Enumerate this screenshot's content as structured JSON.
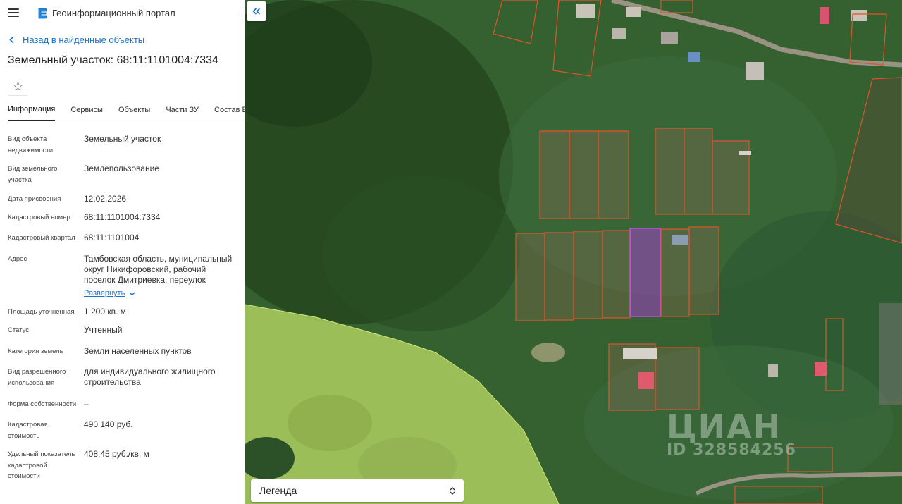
{
  "header": {
    "portal_title": "Геоинформационный портал",
    "menu_icon": "burger-icon",
    "logo_icon": "portal-logo-icon"
  },
  "nav": {
    "back_label": "Назад в найденные объекты"
  },
  "object": {
    "title": "Земельный участок: 68:11:1101004:7334"
  },
  "tabs": [
    {
      "label": "Информация",
      "active": true
    },
    {
      "label": "Сервисы",
      "active": false
    },
    {
      "label": "Объекты",
      "active": false
    },
    {
      "label": "Части ЗУ",
      "active": false
    },
    {
      "label": "Состав ЕЗП",
      "active": false
    }
  ],
  "properties": [
    {
      "label": "Вид объекта недвижимости",
      "value": "Земельный участок"
    },
    {
      "label": "Вид земельного участка",
      "value": "Землепользование"
    },
    {
      "label": "Дата присвоения",
      "value": "12.02.2026"
    },
    {
      "label": "Кадастровый номер",
      "value": "68:11:1101004:7334"
    },
    {
      "label": "Кадастровый квартал",
      "value": "68:11:1101004"
    },
    {
      "label": "Адрес",
      "value": "Тамбовская область, муниципальный округ Никифоровский, рабочий поселок Дмитриевка, переулок"
    },
    {
      "label": "Площадь уточненная",
      "value": "1 200 кв. м"
    },
    {
      "label": "Статус",
      "value": "Учтенный"
    },
    {
      "label": "Категория земель",
      "value": "Земли населенных пунктов"
    },
    {
      "label": "Вид разрешенного использования",
      "value": "для индивидуального жилищного строительства"
    },
    {
      "label": "Форма собственности",
      "value": "–"
    },
    {
      "label": "Кадастровая стоимость",
      "value": "490 140 руб."
    },
    {
      "label": "Удельный показатель кадастровой стоимости",
      "value": "408,45 руб./кв. м"
    }
  ],
  "address_expand_label": "Развернуть",
  "map": {
    "legend_label": "Легенда",
    "watermark_brand": "ЦИАН",
    "watermark_id": "ID 328584256",
    "colors": {
      "parcel_border": "#e0542a",
      "selected_parcel": "#a040c8",
      "zone_fill": "#c8e86a"
    }
  }
}
